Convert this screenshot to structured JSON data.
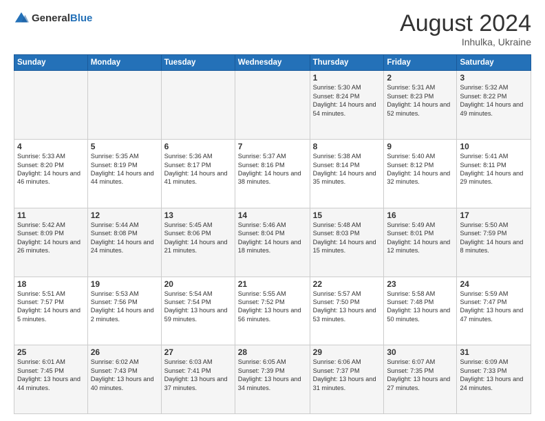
{
  "header": {
    "logo": {
      "general": "General",
      "blue": "Blue"
    },
    "title": "August 2024",
    "location": "Inhulka, Ukraine"
  },
  "weekdays": [
    "Sunday",
    "Monday",
    "Tuesday",
    "Wednesday",
    "Thursday",
    "Friday",
    "Saturday"
  ],
  "weeks": [
    [
      {
        "day": "",
        "info": ""
      },
      {
        "day": "",
        "info": ""
      },
      {
        "day": "",
        "info": ""
      },
      {
        "day": "",
        "info": ""
      },
      {
        "day": "1",
        "info": "Sunrise: 5:30 AM\nSunset: 8:24 PM\nDaylight: 14 hours\nand 54 minutes."
      },
      {
        "day": "2",
        "info": "Sunrise: 5:31 AM\nSunset: 8:23 PM\nDaylight: 14 hours\nand 52 minutes."
      },
      {
        "day": "3",
        "info": "Sunrise: 5:32 AM\nSunset: 8:22 PM\nDaylight: 14 hours\nand 49 minutes."
      }
    ],
    [
      {
        "day": "4",
        "info": "Sunrise: 5:33 AM\nSunset: 8:20 PM\nDaylight: 14 hours\nand 46 minutes."
      },
      {
        "day": "5",
        "info": "Sunrise: 5:35 AM\nSunset: 8:19 PM\nDaylight: 14 hours\nand 44 minutes."
      },
      {
        "day": "6",
        "info": "Sunrise: 5:36 AM\nSunset: 8:17 PM\nDaylight: 14 hours\nand 41 minutes."
      },
      {
        "day": "7",
        "info": "Sunrise: 5:37 AM\nSunset: 8:16 PM\nDaylight: 14 hours\nand 38 minutes."
      },
      {
        "day": "8",
        "info": "Sunrise: 5:38 AM\nSunset: 8:14 PM\nDaylight: 14 hours\nand 35 minutes."
      },
      {
        "day": "9",
        "info": "Sunrise: 5:40 AM\nSunset: 8:12 PM\nDaylight: 14 hours\nand 32 minutes."
      },
      {
        "day": "10",
        "info": "Sunrise: 5:41 AM\nSunset: 8:11 PM\nDaylight: 14 hours\nand 29 minutes."
      }
    ],
    [
      {
        "day": "11",
        "info": "Sunrise: 5:42 AM\nSunset: 8:09 PM\nDaylight: 14 hours\nand 26 minutes."
      },
      {
        "day": "12",
        "info": "Sunrise: 5:44 AM\nSunset: 8:08 PM\nDaylight: 14 hours\nand 24 minutes."
      },
      {
        "day": "13",
        "info": "Sunrise: 5:45 AM\nSunset: 8:06 PM\nDaylight: 14 hours\nand 21 minutes."
      },
      {
        "day": "14",
        "info": "Sunrise: 5:46 AM\nSunset: 8:04 PM\nDaylight: 14 hours\nand 18 minutes."
      },
      {
        "day": "15",
        "info": "Sunrise: 5:48 AM\nSunset: 8:03 PM\nDaylight: 14 hours\nand 15 minutes."
      },
      {
        "day": "16",
        "info": "Sunrise: 5:49 AM\nSunset: 8:01 PM\nDaylight: 14 hours\nand 12 minutes."
      },
      {
        "day": "17",
        "info": "Sunrise: 5:50 AM\nSunset: 7:59 PM\nDaylight: 14 hours\nand 8 minutes."
      }
    ],
    [
      {
        "day": "18",
        "info": "Sunrise: 5:51 AM\nSunset: 7:57 PM\nDaylight: 14 hours\nand 5 minutes."
      },
      {
        "day": "19",
        "info": "Sunrise: 5:53 AM\nSunset: 7:56 PM\nDaylight: 14 hours\nand 2 minutes."
      },
      {
        "day": "20",
        "info": "Sunrise: 5:54 AM\nSunset: 7:54 PM\nDaylight: 13 hours\nand 59 minutes."
      },
      {
        "day": "21",
        "info": "Sunrise: 5:55 AM\nSunset: 7:52 PM\nDaylight: 13 hours\nand 56 minutes."
      },
      {
        "day": "22",
        "info": "Sunrise: 5:57 AM\nSunset: 7:50 PM\nDaylight: 13 hours\nand 53 minutes."
      },
      {
        "day": "23",
        "info": "Sunrise: 5:58 AM\nSunset: 7:48 PM\nDaylight: 13 hours\nand 50 minutes."
      },
      {
        "day": "24",
        "info": "Sunrise: 5:59 AM\nSunset: 7:47 PM\nDaylight: 13 hours\nand 47 minutes."
      }
    ],
    [
      {
        "day": "25",
        "info": "Sunrise: 6:01 AM\nSunset: 7:45 PM\nDaylight: 13 hours\nand 44 minutes."
      },
      {
        "day": "26",
        "info": "Sunrise: 6:02 AM\nSunset: 7:43 PM\nDaylight: 13 hours\nand 40 minutes."
      },
      {
        "day": "27",
        "info": "Sunrise: 6:03 AM\nSunset: 7:41 PM\nDaylight: 13 hours\nand 37 minutes."
      },
      {
        "day": "28",
        "info": "Sunrise: 6:05 AM\nSunset: 7:39 PM\nDaylight: 13 hours\nand 34 minutes."
      },
      {
        "day": "29",
        "info": "Sunrise: 6:06 AM\nSunset: 7:37 PM\nDaylight: 13 hours\nand 31 minutes."
      },
      {
        "day": "30",
        "info": "Sunrise: 6:07 AM\nSunset: 7:35 PM\nDaylight: 13 hours\nand 27 minutes."
      },
      {
        "day": "31",
        "info": "Sunrise: 6:09 AM\nSunset: 7:33 PM\nDaylight: 13 hours\nand 24 minutes."
      }
    ]
  ]
}
